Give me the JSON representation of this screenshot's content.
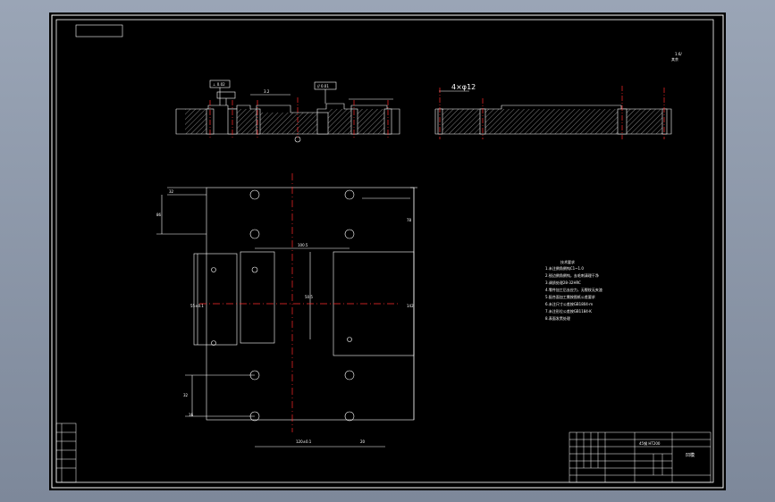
{
  "drawing": {
    "colors": {
      "background": "#000000",
      "line": "#ffffff",
      "centerline": "#ff2a2a",
      "frame_bg": "#8a95a7"
    },
    "section_view": {
      "gdt_1": "⊥ 0.02",
      "gdt_2": "// 0.01",
      "roughness": "3.2",
      "dim_4x": "4×φ12",
      "top_right_note_1": "1.6/",
      "top_right_note_2": "其余"
    },
    "plan_view": {
      "dims": {
        "d_left_top": "32",
        "d_left_mid": "86",
        "d_right_height": "78",
        "d_height_total": "142",
        "d_center_w": "100.5",
        "d_center_h": "50.5",
        "d_left_slot": "55±0.1",
        "d_bottom_width": "120±0.1",
        "d_bottom_right": "20",
        "d_bottom_left_a": "32",
        "d_bottom_left_b": "16"
      }
    },
    "tech_requirements": {
      "title": "技术要求",
      "items": [
        "1.未注倒角倒钝C1~1.0",
        "2.锐边倒角倒钝，去毛刺清理干净",
        "3.调质处理28-32HRC",
        "4.零件加工后去应力，无裂纹无夹渣",
        "5.配合面加工需按图纸公差要求",
        "6.未注尺寸公差按GB1804-m",
        "7.未注形位公差按GB1184-K",
        "8.表面发黑处理"
      ]
    },
    "title_block": {
      "material": "45钢  HT200",
      "name": "凹模"
    }
  }
}
